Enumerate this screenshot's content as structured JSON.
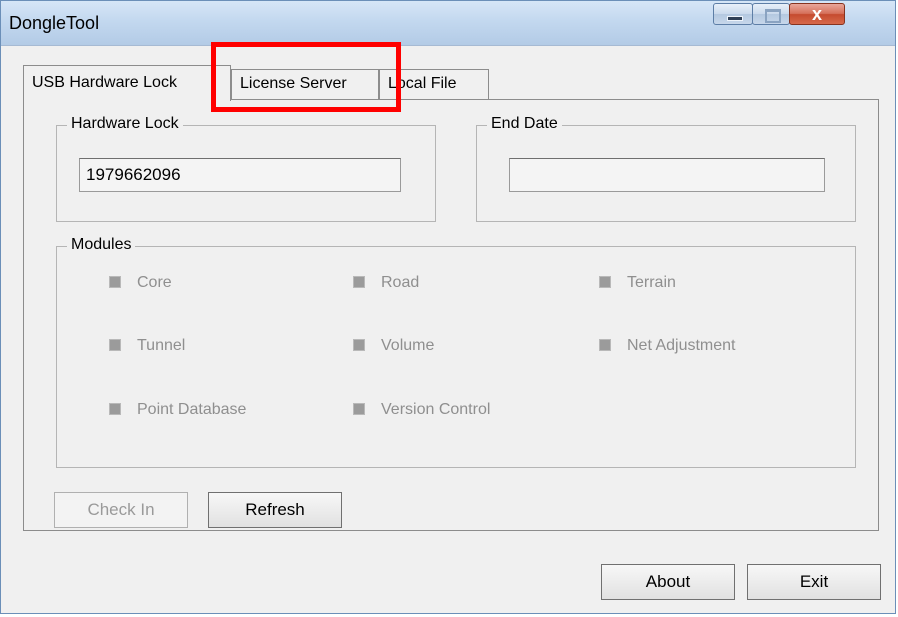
{
  "window": {
    "title": "DongleTool",
    "controls": {
      "minimize": "",
      "maximize": "",
      "close": "x"
    }
  },
  "tabs": [
    {
      "label": "USB Hardware Lock",
      "active": true
    },
    {
      "label": "License Server",
      "active": false
    },
    {
      "label": "Local File",
      "active": false
    }
  ],
  "hardware_lock": {
    "label": "Hardware Lock",
    "value": "1979662096"
  },
  "end_date": {
    "label": "End Date",
    "value": ""
  },
  "modules": {
    "label": "Modules",
    "items": [
      "Core",
      "Road",
      "Terrain",
      "Tunnel",
      "Volume",
      "Net Adjustment",
      "Point Database",
      "Version Control"
    ]
  },
  "buttons": {
    "check_in": "Check In",
    "refresh": "Refresh",
    "about": "About",
    "exit": "Exit"
  },
  "colors": {
    "highlight": "#ff0000",
    "disabled_text": "#8f8f8f"
  }
}
